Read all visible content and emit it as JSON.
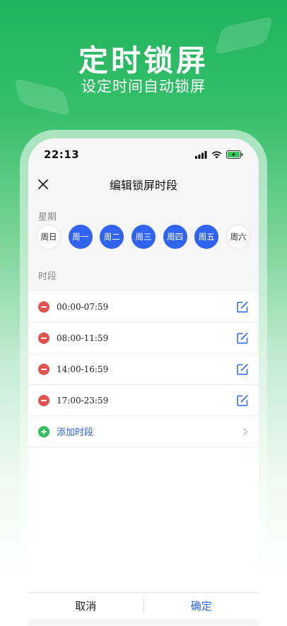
{
  "hero": {
    "title": "定时锁屏",
    "subtitle": "设定时间自动锁屏"
  },
  "status_bar": {
    "time": "22:13",
    "icons": [
      "signal-icon",
      "wifi-icon",
      "battery-charging-icon"
    ]
  },
  "nav": {
    "title": "编辑锁屏时段",
    "close_icon": "close-icon"
  },
  "week": {
    "label": "星期",
    "days": [
      {
        "label": "周日",
        "selected": false
      },
      {
        "label": "周一",
        "selected": true
      },
      {
        "label": "周二",
        "selected": true
      },
      {
        "label": "周三",
        "selected": true
      },
      {
        "label": "周四",
        "selected": true
      },
      {
        "label": "周五",
        "selected": true
      },
      {
        "label": "周六",
        "selected": false
      }
    ]
  },
  "slots": {
    "label": "时段",
    "items": [
      {
        "time": "00:00-07:59"
      },
      {
        "time": "08:00-11:59"
      },
      {
        "time": "14:00-16:59"
      },
      {
        "time": "17:00-23:59"
      }
    ],
    "add_label": "添加时段"
  },
  "footer": {
    "cancel": "取消",
    "confirm": "确定"
  },
  "colors": {
    "accent": "#2f63f0",
    "remove": "#e0534f",
    "add": "#2fbf5c",
    "brand_green": "#1fb45d"
  }
}
